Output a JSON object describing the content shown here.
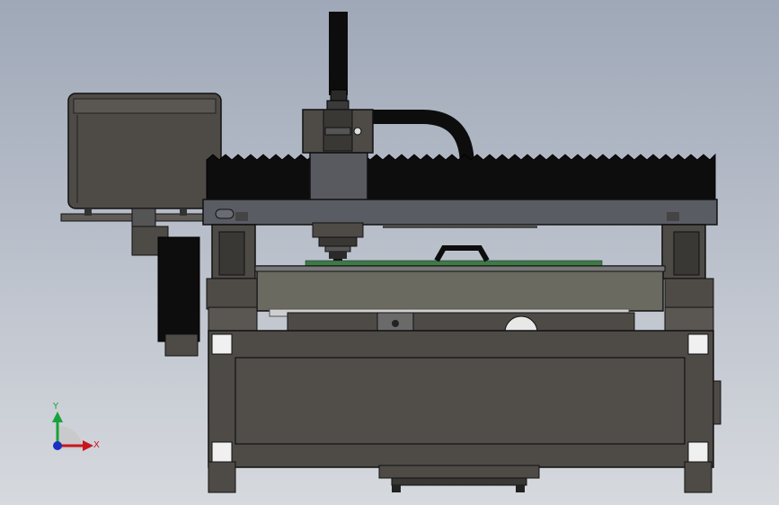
{
  "viewport": {
    "background_top": "#9fa8b8",
    "background_bottom": "#d6d9de"
  },
  "triad": {
    "x_label": "X",
    "y_label": "Y",
    "x_color": "#c8161d",
    "y_color": "#18a23a",
    "z_color": "#1a2fc0"
  },
  "model": {
    "body_color": "#4e4b47",
    "dark_color": "#0d0d0d",
    "gantry_color": "#5a5c64",
    "bed_color": "#6b6a60",
    "pcb_color": "#3f7a45"
  }
}
